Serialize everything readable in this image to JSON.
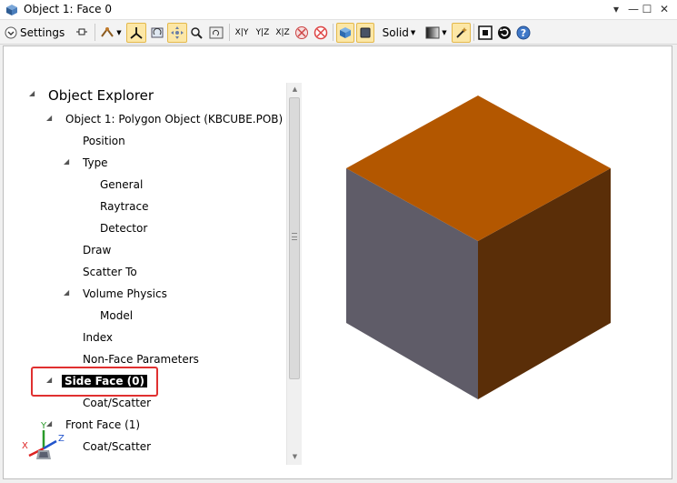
{
  "window": {
    "title": "Object 1: Face 0",
    "minimize": "—",
    "maximize": "☐",
    "close": "✕"
  },
  "toolbar": {
    "settings_label": "Settings",
    "view_xy": "X|Y",
    "view_yz": "Y|Z",
    "view_xz": "X|Z",
    "render_mode": "Solid"
  },
  "tree": {
    "root": "Object Explorer",
    "object": "Object 1: Polygon Object (KBCUBE.POB)",
    "items": {
      "position": "Position",
      "type": "Type",
      "general": "General",
      "raytrace": "Raytrace",
      "detector": "Detector",
      "draw": "Draw",
      "scatter_to": "Scatter To",
      "volume_physics": "Volume Physics",
      "model": "Model",
      "index": "Index",
      "non_face": "Non-Face Parameters",
      "side_face": "Side Face (0)",
      "coat_scatter_1": "Coat/Scatter",
      "front_face": "Front Face (1)",
      "coat_scatter_2": "Coat/Scatter"
    }
  },
  "axes": {
    "x": "X",
    "y": "Y",
    "z": "Z"
  },
  "colors": {
    "cube_top": "#b35700",
    "cube_left": "#5f5c68",
    "cube_right": "#5a2e08",
    "selection_outline": "#e03030",
    "active_button": "#fce7a6"
  }
}
